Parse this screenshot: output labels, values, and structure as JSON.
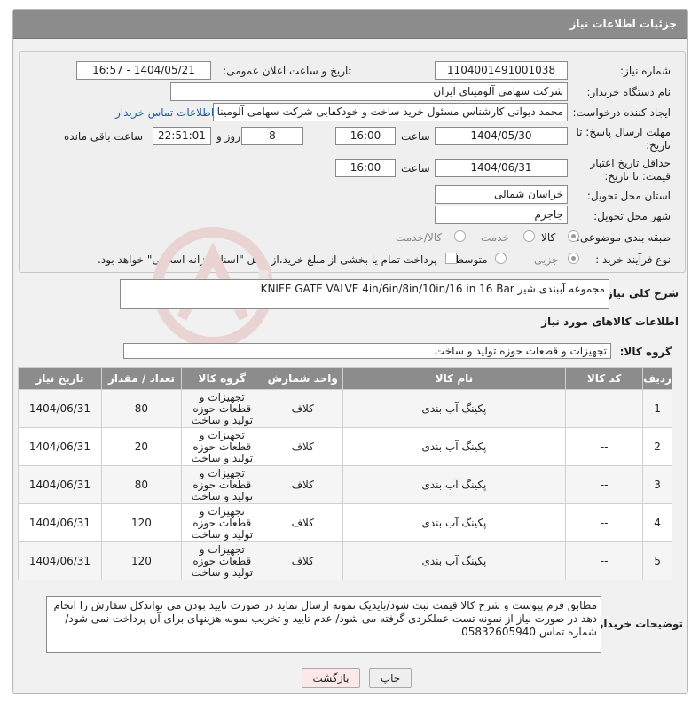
{
  "header": {
    "title": "جزئیات اطلاعات نیاز"
  },
  "form": {
    "need_number_label": "شماره نیاز:",
    "need_number": "1104001491001038",
    "announce_label": "تاریخ و ساعت اعلان عمومی:",
    "announce_value": "1404/05/21 - 16:57",
    "buyer_org_label": "نام دستگاه خریدار:",
    "buyer_org": "شرکت سهامی آلومینای ایران",
    "creator_label": "ایجاد کننده درخواست:",
    "creator": "محمد دیوانی کارشناس مسئول خرید ساخت و خودکفایی شرکت سهامی آلومینا",
    "buyer_contact_link": "اطلاعات تماس خریدار",
    "reply_deadline_label": "مهلت ارسال پاسخ: تا تاریخ:",
    "reply_date": "1404/05/30",
    "time_label": "ساعت",
    "reply_time": "16:00",
    "days_value": "8",
    "days_label": "روز و",
    "remaining_time": "22:51:01",
    "remaining_label": "ساعت باقی مانده",
    "price_validity_label": "حداقل تاریخ اعتبار قیمت: تا تاریخ:",
    "price_date": "1404/06/31",
    "price_time": "16:00",
    "province_label": "استان محل تحویل:",
    "province": "خراسان شمالی",
    "city_label": "شهر محل تحویل:",
    "city": "جاجرم",
    "category_label": "طبقه بندی موضوعی:",
    "category_options": [
      "کالا",
      "خدمت",
      "کالا/خدمت"
    ],
    "process_label": "نوع فرآیند خرید :",
    "process_options": [
      "جزیی",
      "متوسط"
    ],
    "payment_note": "پرداخت تمام یا بخشی از مبلغ خرید،از محل \"اسناد خزانه اسلامی\" خواهد بود."
  },
  "summary": {
    "label": "شرح کلی نیاز:",
    "value": "مجموعه آببندی شیر KNIFE GATE VALVE 4in/6in/8in/10in/16 in 16 Bar"
  },
  "goods_section": {
    "title": "اطلاعات کالاهای مورد نیاز",
    "group_label": "گروه کالا:",
    "group_value": "تجهیزات و قطعات حوزه تولید و ساخت"
  },
  "table": {
    "headers": [
      "ردیف",
      "کد کالا",
      "نام کالا",
      "واحد شمارش",
      "گروه کالا",
      "تعداد / مقدار",
      "تاریخ نیاز"
    ],
    "rows": [
      {
        "row": "1",
        "code": "--",
        "name": "پکینگ آب بندی",
        "unit": "کلاف",
        "group": "تجهیزات و قطعات حوزه تولید و ساخت",
        "qty": "80",
        "date": "1404/06/31"
      },
      {
        "row": "2",
        "code": "--",
        "name": "پکینگ آب بندی",
        "unit": "کلاف",
        "group": "تجهیزات و قطعات حوزه تولید و ساخت",
        "qty": "20",
        "date": "1404/06/31"
      },
      {
        "row": "3",
        "code": "--",
        "name": "پکینگ آب بندی",
        "unit": "کلاف",
        "group": "تجهیزات و قطعات حوزه تولید و ساخت",
        "qty": "80",
        "date": "1404/06/31"
      },
      {
        "row": "4",
        "code": "--",
        "name": "پکینگ آب بندی",
        "unit": "کلاف",
        "group": "تجهیزات و قطعات حوزه تولید و ساخت",
        "qty": "120",
        "date": "1404/06/31"
      },
      {
        "row": "5",
        "code": "--",
        "name": "پکینگ آب بندی",
        "unit": "کلاف",
        "group": "تجهیزات و قطعات حوزه تولید و ساخت",
        "qty": "120",
        "date": "1404/06/31"
      }
    ]
  },
  "buyer_notes": {
    "label": "توضیحات خریدار:",
    "value": "مطابق فرم پیوست و شرح کالا قیمت ثبت شود/بایدیک نمونه ارسال نماید در صورت تایید بودن می تواندکل سفارش را انجام دهد در صورت نیاز از نمونه تست عملکردی گرفته می شود/ عدم تایید و تخریب نمونه هزینهای برای آن پرداخت نمی شود/ شماره تماس 05832605940"
  },
  "buttons": {
    "print": "چاپ",
    "back": "بازگشت"
  },
  "colors": {
    "header_bg": "#8c8c8c",
    "link": "#1b5fae",
    "back_button_bg": "#fde8e8"
  },
  "watermark": "AriaTender.net"
}
